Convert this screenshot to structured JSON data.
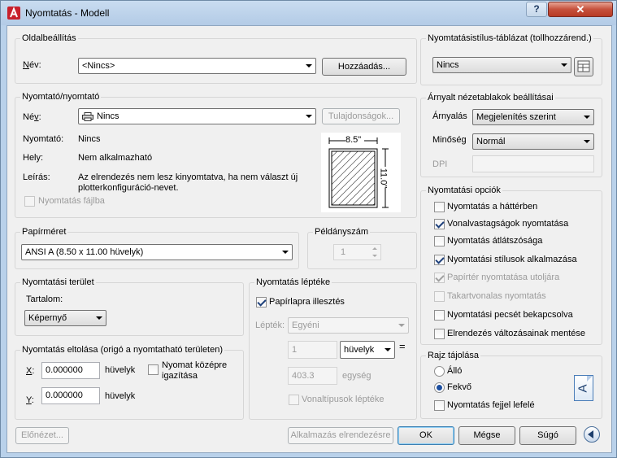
{
  "window": {
    "title": "Nyomtatás - Modell",
    "help": "?",
    "close": "✕"
  },
  "page_setup": {
    "title": "Oldalbeállítás",
    "name_label": "Név:",
    "name_value": "<Nincs>",
    "add_button": "Hozzáadás..."
  },
  "printer": {
    "title": "Nyomtató/nyomtató",
    "name_label": "Név:",
    "name_value": "Nincs",
    "properties_button": "Tulajdonságok...",
    "plotter_label": "Nyomtató:",
    "plotter_value": "Nincs",
    "where_label": "Hely:",
    "where_value": "Nem alkalmazható",
    "desc_label": "Leírás:",
    "desc_line1": "Az elrendezés nem lesz kinyomtatva, ha nem választ új",
    "desc_line2": "plotterkonfiguráció-nevet.",
    "print_to_file": "Nyomtatás fájlba",
    "preview_width": "8.5\"",
    "preview_height": "11.0\""
  },
  "paper_size": {
    "title": "Papírméret",
    "value": "ANSI A (8.50 x 11.00 hüvelyk)"
  },
  "copies": {
    "title": "Példányszám",
    "value": "1"
  },
  "plot_area": {
    "title": "Nyomtatási terület",
    "what_label": "Tartalom:",
    "what_value": "Képernyő"
  },
  "plot_offset": {
    "title": "Nyomtatás eltolása (origó a nyomtatható területen)",
    "x_label": "X:",
    "x_value": "0.000000",
    "x_unit": "hüvelyk",
    "y_label": "Y:",
    "y_value": "0.000000",
    "y_unit": "hüvelyk",
    "center_line1": "Nyomat középre",
    "center_line2": "igazítása"
  },
  "plot_scale": {
    "title": "Nyomtatás léptéke",
    "fit_to_paper": "Papírlapra illesztés",
    "scale_label": "Lépték:",
    "scale_value": "Egyéni",
    "value1": "1",
    "unit_value": "hüvelyk",
    "equals": "=",
    "value2": "403.3",
    "unit2": "egység",
    "scale_lineweights": "Vonaltípusok léptéke"
  },
  "style_table": {
    "title": "Nyomtatásistílus-táblázat (tollhozzárend.)",
    "value": "Nincs"
  },
  "shaded": {
    "title": "Árnyalt nézetablakok beállításai",
    "shade_label": "Árnyalás",
    "shade_value": "Megjelenítés szerint",
    "quality_label": "Minőség",
    "quality_value": "Normál",
    "dpi_label": "DPI"
  },
  "options": {
    "title": "Nyomtatási opciók",
    "items": [
      {
        "label": "Nyomtatás a háttérben",
        "checked": false,
        "enabled": true
      },
      {
        "label": "Vonalvastagságok nyomtatása",
        "checked": true,
        "enabled": true
      },
      {
        "label": "Nyomtatás átlátszósága",
        "checked": false,
        "enabled": true
      },
      {
        "label": "Nyomtatási stílusok alkalmazása",
        "checked": true,
        "enabled": true
      },
      {
        "label": "Papírtér nyomtatása utoljára",
        "checked": true,
        "enabled": false
      },
      {
        "label": "Takartvonalas nyomtatás",
        "checked": false,
        "enabled": false
      },
      {
        "label": "Nyomtatási pecsét bekapcsolva",
        "checked": false,
        "enabled": true
      },
      {
        "label": "Elrendezés változásainak mentése",
        "checked": false,
        "enabled": true
      }
    ]
  },
  "orientation": {
    "title": "Rajz tájolása",
    "portrait": "Álló",
    "landscape": "Fekvő",
    "upside_down": "Nyomtatás fejjel lefelé",
    "icon_letter": "A"
  },
  "footer": {
    "preview": "Előnézet...",
    "apply": "Alkalmazás elrendezésre",
    "ok": "OK",
    "cancel": "Mégse",
    "help": "Súgó"
  }
}
